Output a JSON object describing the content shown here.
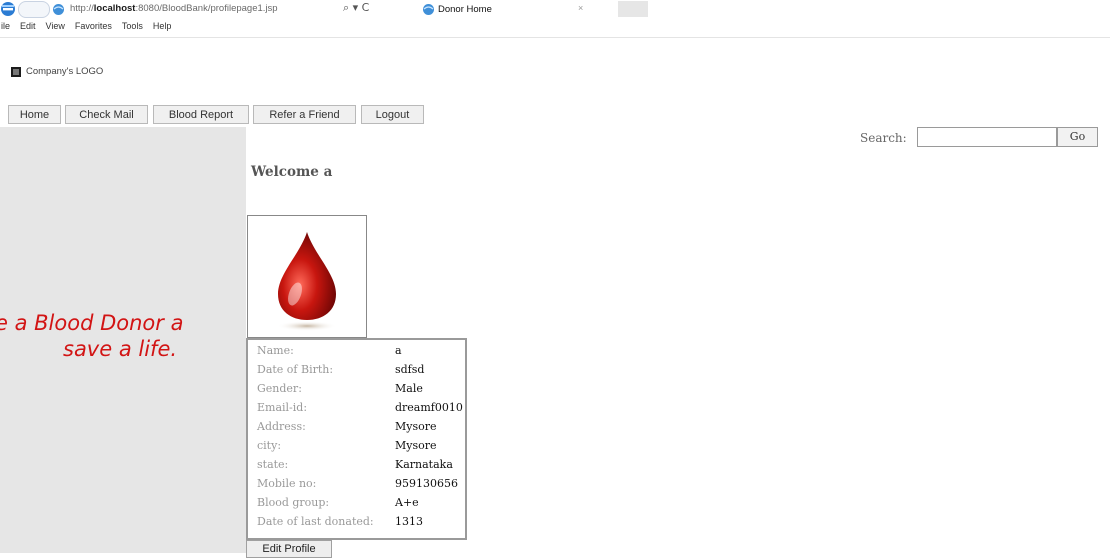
{
  "browser": {
    "url_prefix": "http://",
    "url_host": "localhost",
    "url_path": ":8080/BloodBank/profilepage1.jsp",
    "search_glyph": "⌕ ▾ C",
    "tab_title": "Donor Home",
    "tab_close": "×",
    "menu": [
      "ile",
      "Edit",
      "View",
      "Favorites",
      "Tools",
      "Help"
    ]
  },
  "header": {
    "logo_text": "Company's LOGO"
  },
  "nav": [
    "Home",
    "Check Mail",
    "Blood Report",
    "Refer a Friend",
    "Logout"
  ],
  "search": {
    "label": "Search:",
    "value": "",
    "button": "Go"
  },
  "sidebar": {
    "slogan_line1": "e a Blood Donor a",
    "slogan_line2": "save a life."
  },
  "main": {
    "welcome": "Welcome a",
    "drop_icon": "blood-drop-icon",
    "profile": [
      {
        "label": "Name:",
        "value": "a"
      },
      {
        "label": "Date of Birth:",
        "value": "sdfsd"
      },
      {
        "label": "Gender:",
        "value": "Male"
      },
      {
        "label": "Email-id:",
        "value": "dreamf0010"
      },
      {
        "label": "Address:",
        "value": "Mysore"
      },
      {
        "label": "city:",
        "value": "Mysore"
      },
      {
        "label": "state:",
        "value": "Karnataka"
      },
      {
        "label": "Mobile no:",
        "value": "959130656"
      },
      {
        "label": "Blood group:",
        "value": "A+e"
      },
      {
        "label": "Date of last donated:",
        "value": "1313"
      }
    ],
    "edit_button": "Edit Profile"
  },
  "colors": {
    "accent": "#d21414",
    "sidebar_bg": "#e6e6e6"
  }
}
